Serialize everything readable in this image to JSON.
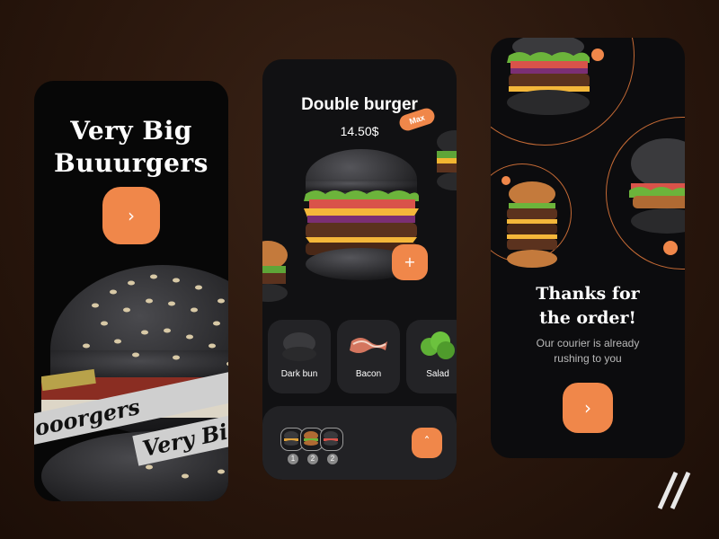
{
  "screen1": {
    "title_line1": "Very Big",
    "title_line2": "Buuurgers",
    "tape_text_1": "Very Bi",
    "tape_text_2": "ooorgers",
    "cta_icon": "chevron-right-icon"
  },
  "screen2": {
    "title": "Double burger",
    "price": "14.50$",
    "badge": "Max",
    "add_icon": "plus",
    "ingredients": [
      {
        "label": "Dark bun",
        "icon": "dark-bun-icon"
      },
      {
        "label": "Bacon",
        "icon": "bacon-icon"
      },
      {
        "label": "Salad",
        "icon": "salad-icon"
      }
    ],
    "cart": {
      "items": [
        {
          "qty": "1"
        },
        {
          "qty": "2"
        },
        {
          "qty": "2"
        }
      ],
      "expand_icon": "chevron-up-icon"
    }
  },
  "screen3": {
    "title_line1": "Thanks for",
    "title_line2": "the order!",
    "subtitle_line1": "Our courier is already",
    "subtitle_line2": "rushing to you",
    "cta_icon": "chevron-right-icon"
  },
  "colors": {
    "accent": "#f0874a",
    "background": "#2a170d",
    "card": "#111113"
  }
}
